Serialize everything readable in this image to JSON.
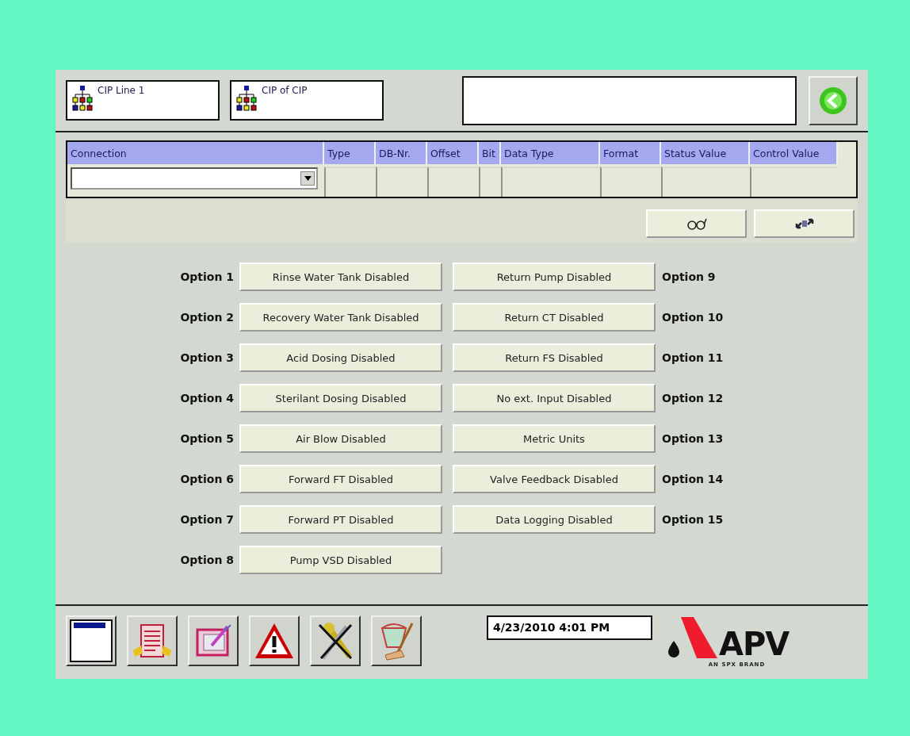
{
  "nav_buttons": [
    {
      "label": "CIP Line 1"
    },
    {
      "label": "CIP of CIP"
    }
  ],
  "table": {
    "columns": [
      "Connection",
      "Type",
      "DB-Nr.",
      "Offset",
      "Bit",
      "Data Type",
      "Format",
      "Status Value",
      "Control Value"
    ]
  },
  "options_left": [
    {
      "label": "Option 1",
      "button": "Rinse Water Tank Disabled"
    },
    {
      "label": "Option 2",
      "button": "Recovery Water Tank Disabled"
    },
    {
      "label": "Option 3",
      "button": "Acid Dosing Disabled"
    },
    {
      "label": "Option 4",
      "button": "Sterilant Dosing Disabled"
    },
    {
      "label": "Option 5",
      "button": "Air Blow Disabled"
    },
    {
      "label": "Option 6",
      "button": "Forward FT Disabled"
    },
    {
      "label": "Option 7",
      "button": "Forward PT Disabled"
    },
    {
      "label": "Option 8",
      "button": "Pump VSD Disabled"
    }
  ],
  "options_right": [
    {
      "label": "Option 9",
      "button": "Return Pump Disabled"
    },
    {
      "label": "Option 10",
      "button": "Return CT Disabled"
    },
    {
      "label": "Option 11",
      "button": "Return FS Disabled"
    },
    {
      "label": "Option 12",
      "button": "No ext. Input Disabled"
    },
    {
      "label": "Option 13",
      "button": "Metric Units"
    },
    {
      "label": "Option 14",
      "button": "Valve Feedback Disabled"
    },
    {
      "label": "Option 15",
      "button": "Data Logging Disabled"
    }
  ],
  "datetime": "4/23/2010 4:01 PM",
  "logo": {
    "name": "APV",
    "tagline": "AN SPX BRAND"
  }
}
